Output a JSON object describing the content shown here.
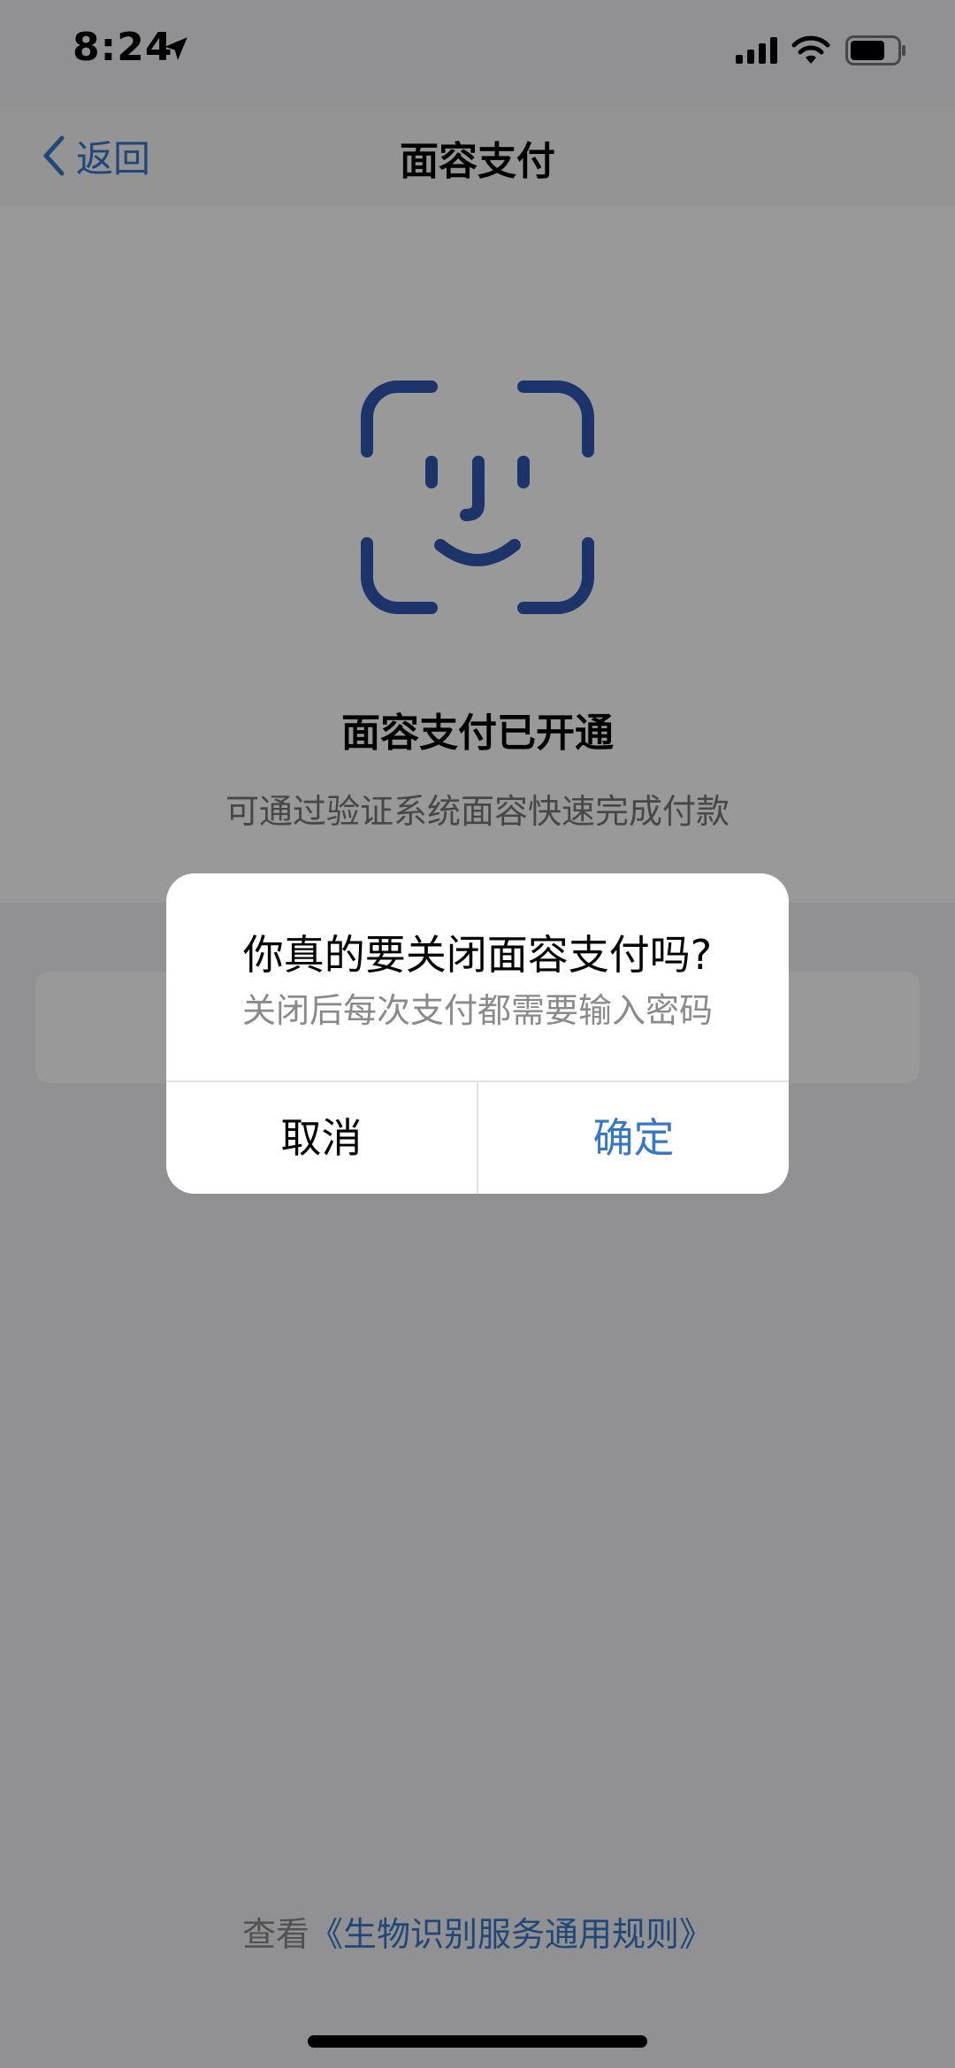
{
  "status_bar": {
    "time": "8:24"
  },
  "nav": {
    "back_label": "返回",
    "title": "面容支付"
  },
  "content": {
    "status_title": "面容支付已开通",
    "status_desc": "可通过验证系统面容快速完成付款"
  },
  "footer": {
    "rules_prefix": "查看",
    "rules_link": "《生物识别服务通用规则》"
  },
  "dialog": {
    "title": "你真的要关闭面容支付吗?",
    "message": "关闭后每次支付都需要输入密码",
    "cancel_label": "取消",
    "confirm_label": "确定"
  },
  "colors": {
    "accent": "#3677c6",
    "face_icon": "#2f58b0",
    "overlay": "rgba(0,0,0,0.4)"
  },
  "icons": {
    "location": "location-arrow-icon",
    "signal": "cellular-signal-icon",
    "wifi": "wifi-icon",
    "battery": "battery-icon",
    "back": "chevron-left-icon",
    "face": "face-id-icon"
  }
}
